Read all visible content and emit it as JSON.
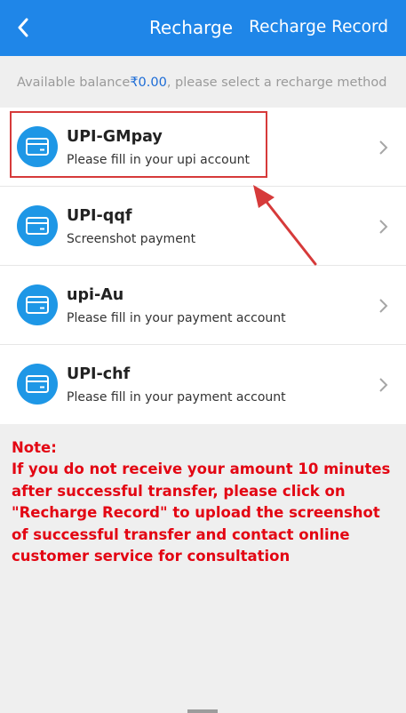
{
  "header": {
    "back_icon": "chevron-left-icon",
    "title": "Recharge",
    "record_label": "Recharge Record",
    "background": "#1f86e8"
  },
  "balance": {
    "prefix": "Available balance",
    "amount": "₹0.00",
    "suffix": ", please select a recharge method"
  },
  "methods": [
    {
      "name": "UPI-GMpay",
      "desc": "Please fill in your upi account",
      "icon": "card-icon",
      "highlighted": true
    },
    {
      "name": "UPI-qqf",
      "desc": "Screenshot payment",
      "icon": "card-icon"
    },
    {
      "name": "upi-Au",
      "desc": "Please fill in your payment account",
      "icon": "card-icon"
    },
    {
      "name": "UPI-chf",
      "desc": "Please fill in your payment account",
      "icon": "card-icon"
    }
  ],
  "note": {
    "title": "Note:",
    "body": "If you do not receive your amount 10 minutes after successful transfer, please click on \"Recharge Record\" to upload the screenshot of successful transfer and contact online customer service for consultation",
    "color": "#e30613"
  },
  "annotation": {
    "color": "#d63a3a"
  }
}
